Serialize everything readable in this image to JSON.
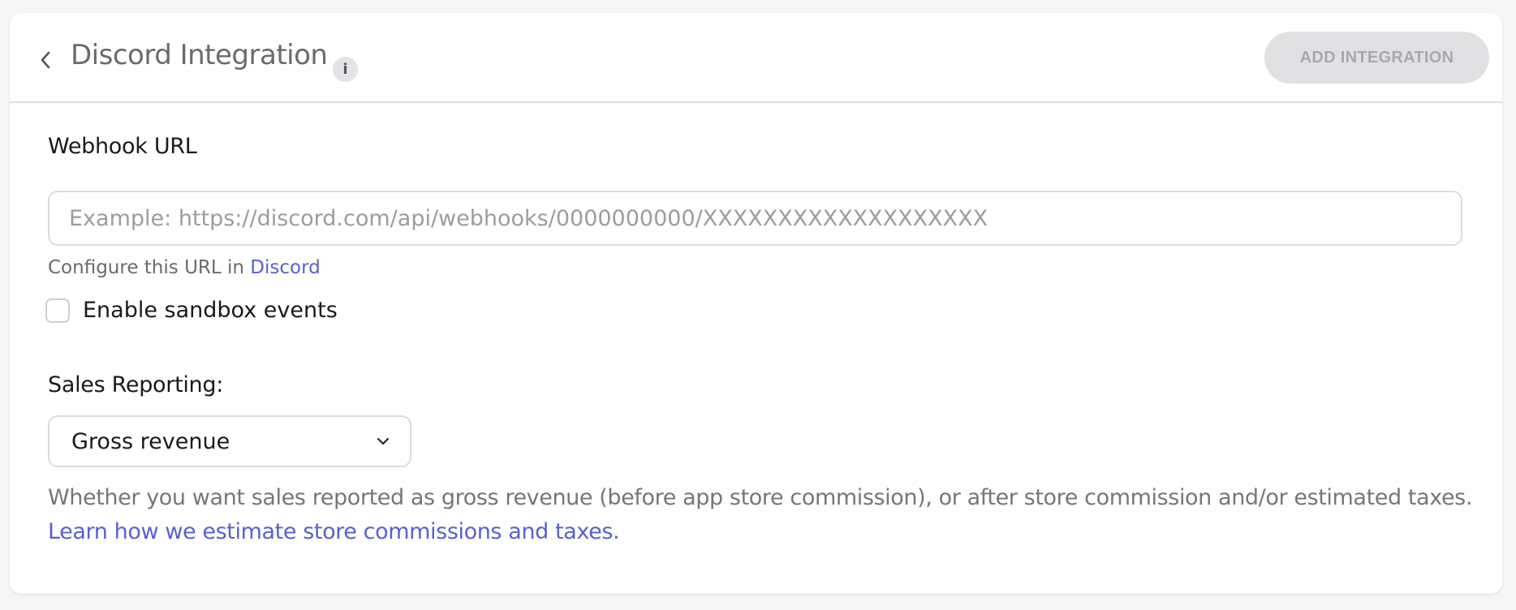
{
  "header": {
    "title": "Discord Integration",
    "info_glyph": "i",
    "back_icon": "chevron-left-icon",
    "add_button_label": "ADD INTEGRATION"
  },
  "webhook": {
    "label": "Webhook URL",
    "value": "",
    "placeholder": "Example: https://discord.com/api/webhooks/0000000000/XXXXXXXXXXXXXXXXXXX",
    "helper_text": "Configure this URL in ",
    "helper_link": "Discord"
  },
  "sandbox": {
    "label": "Enable sandbox events",
    "checked": false
  },
  "sales_reporting": {
    "label": "Sales Reporting:",
    "selected": "Gross revenue",
    "description": "Whether you want sales reported as gross revenue (before app store commission), or after store commission and/or estimated taxes.",
    "learn_link": "Learn how we estimate store commissions and taxes."
  },
  "colors": {
    "link": "#5a5fd4",
    "disabled_button_bg": "#e1e1e3",
    "disabled_button_text": "#a9a9ad",
    "title": "#6a6a6f"
  }
}
